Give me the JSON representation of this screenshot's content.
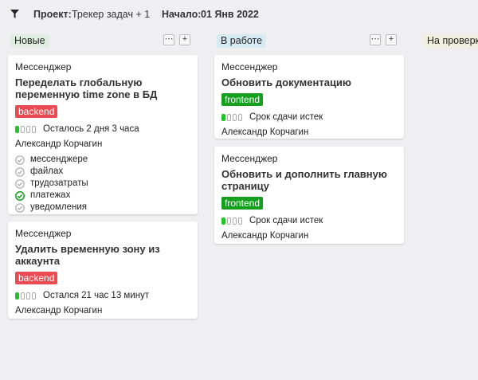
{
  "header": {
    "project_label": "Проект:",
    "project_value": "Трекер задач + 1",
    "start_label": "Начало:",
    "start_value": "01 Янв 2022"
  },
  "columns": [
    {
      "title": "Новые",
      "color": "#dfeee0"
    },
    {
      "title": "В работе",
      "color": "#d5eaf2"
    },
    {
      "title": "На проверке",
      "color": "#f0f0e0"
    }
  ],
  "column_buttons": {
    "more": "⋯",
    "add": "+"
  },
  "cards": {
    "new_1": {
      "project": "Мессенджер",
      "title": "Переделать глобальную переменную time zone в БД",
      "tag": "backend",
      "progress": "1 of 4",
      "status": "Осталось 2 дня 3 часа",
      "assignee": "Александр Корчагин",
      "checklist": [
        {
          "label": "мессенджере",
          "done": false
        },
        {
          "label": "файлах",
          "done": false
        },
        {
          "label": "трудозатраты",
          "done": false
        },
        {
          "label": "платежах",
          "done": true
        },
        {
          "label": "уведомления",
          "done": false
        }
      ]
    },
    "new_2": {
      "project": "Мессенджер",
      "title": "Удалить временную зону из аккаунта",
      "tag": "backend",
      "progress": "1 of 4",
      "status": "Остался 21 час 13 минут",
      "assignee": "Александр Корчагин"
    },
    "work_1": {
      "project": "Мессенджер",
      "title": "Обновить документацию",
      "tag": "frontend",
      "progress": "1 of 4",
      "status": "Срок сдачи истек",
      "assignee": "Александр Корчагин"
    },
    "work_2": {
      "project": "Мессенджер",
      "title": "Обновить и дополнить главную страницу",
      "tag": "frontend",
      "progress": "1 of 4",
      "status": "Срок сдачи истек",
      "assignee": "Александр Корчагин"
    }
  },
  "colors": {
    "backend_tag": "#ea4b53",
    "frontend_tag": "#14a01e",
    "progress_on": "#22c22a",
    "background": "#efeff1"
  }
}
